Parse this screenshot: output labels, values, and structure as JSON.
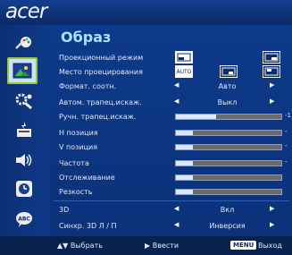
{
  "brand": {
    "logo": "acer"
  },
  "title": "Образ",
  "rows": [
    {
      "label": "Проекционный режим"
    },
    {
      "label": "Место проецирования"
    },
    {
      "label": "Формат. соотн.",
      "value": "Авто"
    },
    {
      "label": "Автом. трапец.искаж.",
      "value": "Выкл"
    },
    {
      "label": "Ручн. трапец.искаж.",
      "slider_end": "-1"
    },
    {
      "label": "H позиция",
      "slider_end": "-"
    },
    {
      "label": "V позиция",
      "slider_end": "-"
    },
    {
      "label": "Частота",
      "slider_end": "-"
    },
    {
      "label": "Отслеживание",
      "slider_end": ""
    },
    {
      "label": "Резкость",
      "slider_end": ""
    },
    {
      "label": "3D",
      "value": "Вкл"
    },
    {
      "label": "Синхр. 3D Л / П",
      "value": "Инверсия"
    }
  ],
  "projection_modes": [
    "",
    "",
    "",
    ""
  ],
  "auto_label": "AUTO",
  "footer": {
    "select": "Выбрать",
    "enter": "Ввести",
    "menu_key": "MENU",
    "exit": "Выход"
  },
  "sidebar_icons": [
    "color-wand-icon",
    "image-icon",
    "settings-wrench-icon",
    "management-icon",
    "audio-icon",
    "timer-icon",
    "language-abc-icon"
  ],
  "colors": {
    "accent": "#aee0ff",
    "active_border": "#8fd030",
    "background": "#0c3a86"
  }
}
